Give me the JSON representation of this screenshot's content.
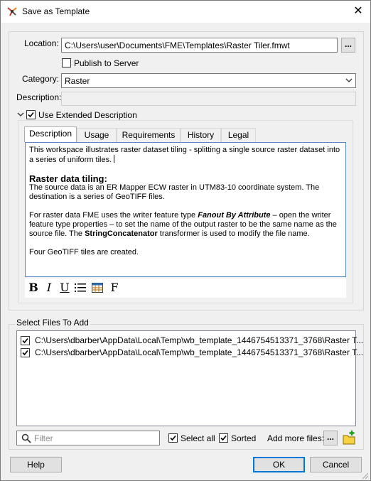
{
  "window": {
    "title": "Save as Template",
    "close_glyph": "✕"
  },
  "form": {
    "location_label": "Location:",
    "location_value": "C:\\Users\\user\\Documents\\FME\\Templates\\Raster Tiler.fmwt",
    "browse_label": "...",
    "publish_label": "Publish to Server",
    "publish_checked": false,
    "category_label": "Category:",
    "category_value": "Raster",
    "description_label": "Description:",
    "description_value": "",
    "extended_label": "Use Extended Description",
    "extended_checked": true
  },
  "tabs": [
    "Description",
    "Usage",
    "Requirements",
    "History",
    "Legal"
  ],
  "active_tab": "Description",
  "extended_description": {
    "para1": "This workspace illustrates raster dataset tiling - splitting a single source raster dataset into a series of uniform tiles.",
    "heading": "Raster data tiling:",
    "para2": "The source data is an ER Mapper ECW raster in UTM83-10 coordinate system. The destination is a series of GeoTIFF files.",
    "para3_a": "For raster data FME uses the writer feature type ",
    "para3_b": "Fanout By Attribute",
    "para3_c": " – open the writer feature type properties – to set the name of the output raster to be the same name as the source file. The ",
    "para3_d": "StringConcatenator",
    "para3_e": " transformer is used to modify the file name.",
    "para4": "Four GeoTIFF tiles are created."
  },
  "format_toolbar": {
    "bold_icon": "bold-icon",
    "italic_icon": "italic-icon",
    "underline_icon": "underline-icon",
    "list_icon": "bullet-list-icon",
    "table_icon": "table-icon",
    "font_icon": "font-icon"
  },
  "files": {
    "group_label": "Select Files To Add",
    "items": [
      {
        "path": "C:\\Users\\dbarber\\AppData\\Local\\Temp\\wb_template_1446754513371_3768\\Raster T...",
        "checked": true
      },
      {
        "path": "C:\\Users\\dbarber\\AppData\\Local\\Temp\\wb_template_1446754513371_3768\\Raster T...",
        "checked": true
      }
    ],
    "filter_placeholder": "Filter",
    "select_all_label": "Select all",
    "sorted_label": "Sorted",
    "add_more_label": "Add more files:",
    "add_more_button": "..."
  },
  "buttons": {
    "help": "Help",
    "ok": "OK",
    "cancel": "Cancel"
  },
  "colors": {
    "accent": "#0078d7",
    "border": "#adadad"
  }
}
